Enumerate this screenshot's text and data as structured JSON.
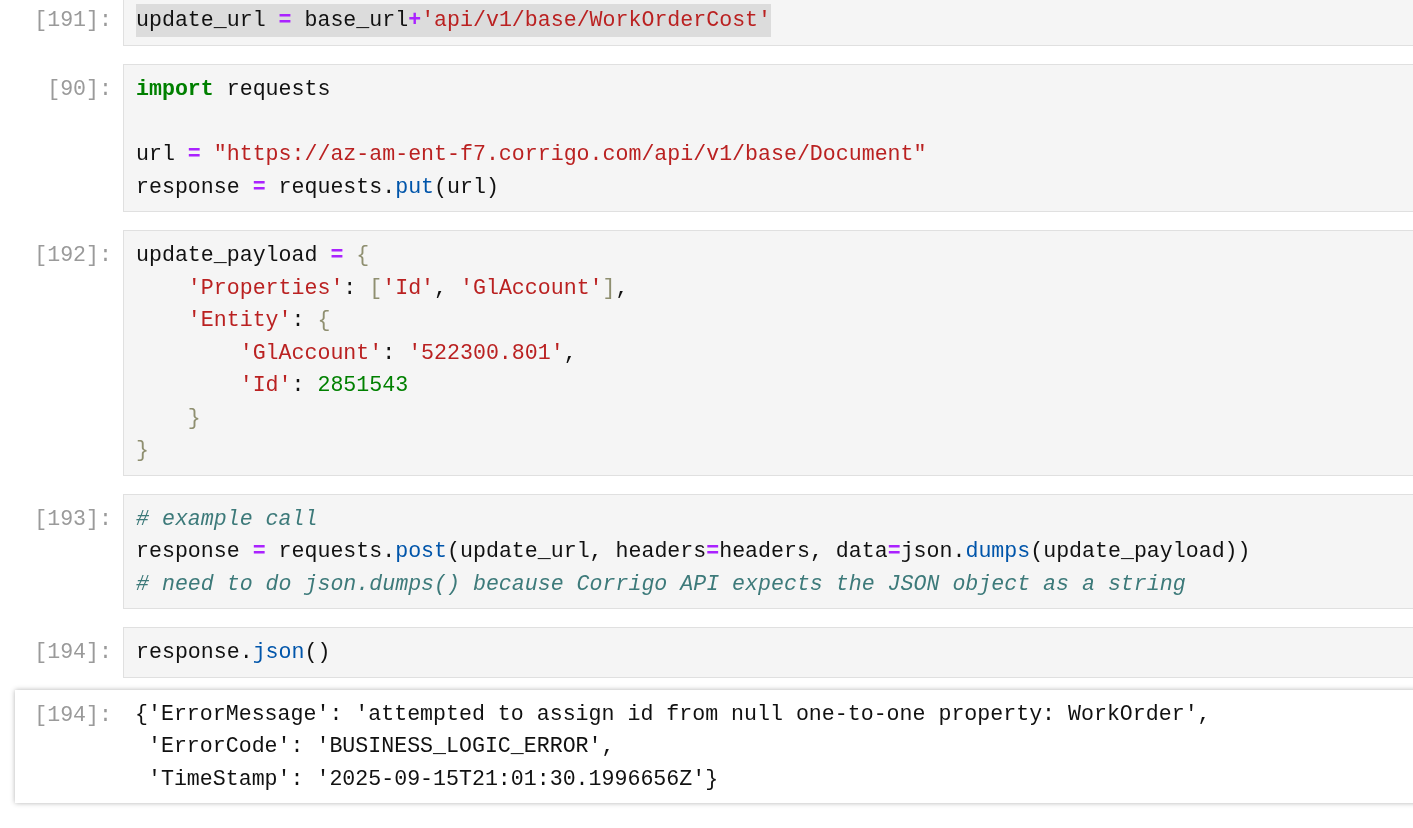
{
  "cells": [
    {
      "kind": "input",
      "prompt": "[191]:",
      "highlighted": true,
      "lines": [
        {
          "kind": "code",
          "tokens": [
            {
              "kind": "plain",
              "text": "update_url "
            },
            {
              "kind": "op",
              "text": "="
            },
            {
              "kind": "plain",
              "text": " base_url"
            },
            {
              "kind": "op",
              "text": "+"
            },
            {
              "kind": "string",
              "text": "'api/v1/base/WorkOrderCost'"
            }
          ]
        }
      ]
    },
    {
      "kind": "input",
      "prompt": "[90]:",
      "highlighted": false,
      "lines": [
        {
          "kind": "code",
          "tokens": [
            {
              "kind": "keyword",
              "text": "import"
            },
            {
              "kind": "plain",
              "text": " requests"
            }
          ]
        },
        {
          "kind": "blank"
        },
        {
          "kind": "code",
          "tokens": [
            {
              "kind": "plain",
              "text": "url "
            },
            {
              "kind": "op",
              "text": "= "
            },
            {
              "kind": "string",
              "text": "\"https://az-am-ent-f7.corrigo.com/api/v1/base/Document\""
            }
          ]
        },
        {
          "kind": "code",
          "tokens": [
            {
              "kind": "plain",
              "text": "response "
            },
            {
              "kind": "op",
              "text": "="
            },
            {
              "kind": "plain",
              "text": " requests."
            },
            {
              "kind": "func",
              "text": "put"
            },
            {
              "kind": "plain",
              "text": "(url)"
            }
          ]
        }
      ]
    },
    {
      "kind": "input",
      "prompt": "[192]:",
      "highlighted": false,
      "lines": [
        {
          "kind": "code",
          "tokens": [
            {
              "kind": "plain",
              "text": "update_payload "
            },
            {
              "kind": "op",
              "text": "= "
            },
            {
              "kind": "punct",
              "text": "{"
            }
          ]
        },
        {
          "kind": "code",
          "tokens": [
            {
              "kind": "string",
              "text": "    'Properties'"
            },
            {
              "kind": "plain",
              "text": ": "
            },
            {
              "kind": "punct",
              "text": "["
            },
            {
              "kind": "string",
              "text": "'Id'"
            },
            {
              "kind": "plain",
              "text": ", "
            },
            {
              "kind": "string",
              "text": "'GlAccount'"
            },
            {
              "kind": "punct",
              "text": "]"
            },
            {
              "kind": "plain",
              "text": ","
            }
          ]
        },
        {
          "kind": "code",
          "tokens": [
            {
              "kind": "string",
              "text": "    'Entity'"
            },
            {
              "kind": "plain",
              "text": ": "
            },
            {
              "kind": "punct",
              "text": "{"
            }
          ]
        },
        {
          "kind": "code",
          "tokens": [
            {
              "kind": "string",
              "text": "        'GlAccount'"
            },
            {
              "kind": "plain",
              "text": ": "
            },
            {
              "kind": "string",
              "text": "'522300.801'"
            },
            {
              "kind": "plain",
              "text": ","
            }
          ]
        },
        {
          "kind": "code",
          "tokens": [
            {
              "kind": "string",
              "text": "        'Id'"
            },
            {
              "kind": "plain",
              "text": ": "
            },
            {
              "kind": "number",
              "text": "2851543"
            }
          ]
        },
        {
          "kind": "code",
          "tokens": [
            {
              "kind": "punct",
              "text": "    }"
            }
          ]
        },
        {
          "kind": "code",
          "tokens": [
            {
              "kind": "punct",
              "text": "}"
            }
          ]
        }
      ]
    },
    {
      "kind": "input",
      "prompt": "[193]:",
      "highlighted": false,
      "lines": [
        {
          "kind": "code",
          "tokens": [
            {
              "kind": "comment",
              "text": "# example call"
            }
          ]
        },
        {
          "kind": "code",
          "tokens": [
            {
              "kind": "plain",
              "text": "response "
            },
            {
              "kind": "op",
              "text": "="
            },
            {
              "kind": "plain",
              "text": " requests."
            },
            {
              "kind": "func",
              "text": "post"
            },
            {
              "kind": "plain",
              "text": "(update_url, headers"
            },
            {
              "kind": "op",
              "text": "="
            },
            {
              "kind": "plain",
              "text": "headers, data"
            },
            {
              "kind": "op",
              "text": "="
            },
            {
              "kind": "plain",
              "text": "json."
            },
            {
              "kind": "func",
              "text": "dumps"
            },
            {
              "kind": "plain",
              "text": "(update_payload))"
            }
          ]
        },
        {
          "kind": "code",
          "tokens": [
            {
              "kind": "comment",
              "text": "# need to do json.dumps() because Corrigo API expects the JSON object as a string"
            }
          ]
        }
      ]
    },
    {
      "kind": "input",
      "prompt": "[194]:",
      "highlighted": false,
      "lines": [
        {
          "kind": "code",
          "tokens": [
            {
              "kind": "plain",
              "text": "response."
            },
            {
              "kind": "func",
              "text": "json"
            },
            {
              "kind": "plain",
              "text": "()"
            }
          ]
        }
      ]
    },
    {
      "kind": "output",
      "prompt": "[194]:",
      "lines": [
        {
          "kind": "code",
          "tokens": [
            {
              "kind": "plain",
              "text": "{'ErrorMessage': 'attempted to assign id from null one-to-one property: WorkOrder',"
            }
          ]
        },
        {
          "kind": "code",
          "tokens": [
            {
              "kind": "plain",
              "text": " 'ErrorCode': 'BUSINESS_LOGIC_ERROR',"
            }
          ]
        },
        {
          "kind": "code",
          "tokens": [
            {
              "kind": "plain",
              "text": " 'TimeStamp': '2025-09-15T21:01:30.1996656Z'}"
            }
          ]
        }
      ]
    }
  ]
}
